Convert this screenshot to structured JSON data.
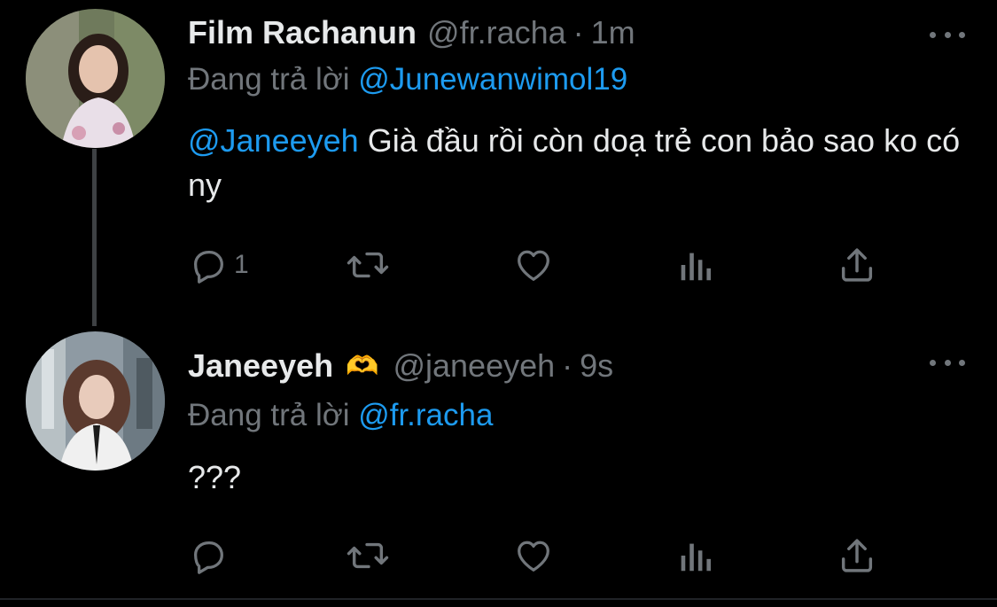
{
  "tweets": [
    {
      "name": "Film Rachanun",
      "emoji": "",
      "handle": "@fr.racha",
      "separator": "·",
      "time": "1m",
      "reply_prefix": "Đang trả lời",
      "reply_to": "@Junewanwimol19",
      "mention": "@Janeeyeh",
      "text": "Già đầu rồi còn doạ trẻ con bảo sao ko có ny",
      "reply_count": "1"
    },
    {
      "name": "Janeeyeh",
      "emoji": "🫶",
      "handle": "@janeeyeh",
      "separator": "·",
      "time": "9s",
      "reply_prefix": "Đang trả lời",
      "reply_to": "@fr.racha",
      "text": "???",
      "reply_count": ""
    }
  ],
  "colors": {
    "background": "#000000",
    "text": "#e7e9ea",
    "muted": "#71767b",
    "link": "#1d9bf0"
  },
  "icons": [
    "reply-icon",
    "retweet-icon",
    "like-icon",
    "views-icon",
    "share-icon",
    "more-icon"
  ]
}
